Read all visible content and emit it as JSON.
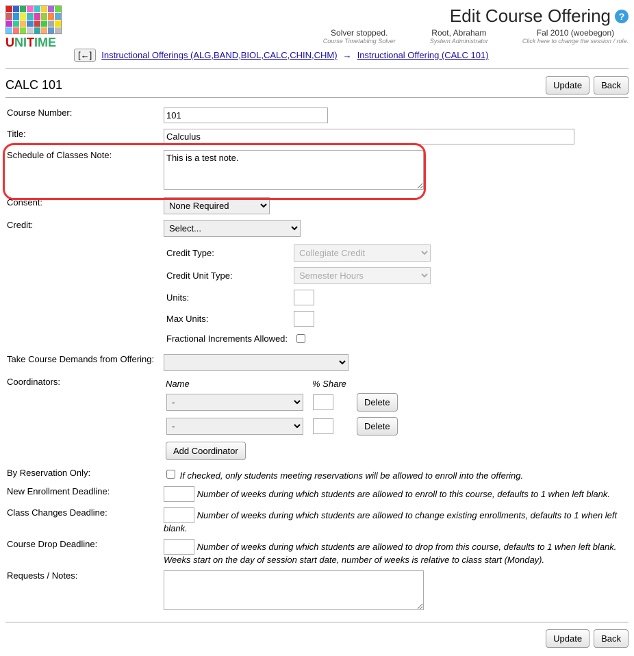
{
  "header": {
    "page_title": "Edit Course Offering",
    "help_icon": "?",
    "status": {
      "solver": {
        "main": "Solver stopped.",
        "sub": "Course Timetabling Solver"
      },
      "user": {
        "main": "Root, Abraham",
        "sub": "System Administrator"
      },
      "session": {
        "main": "Fal 2010 (woebegon)",
        "sub": "Click here to change the session / role."
      }
    },
    "breadcrumb": {
      "back_glyph": "[←]",
      "link1": "Instructional Offerings (ALG,BAND,BIOL,CALC,CHIN,CHM)",
      "arrow": "→",
      "link2": "Instructional Offering (CALC 101)"
    }
  },
  "course": "CALC 101",
  "buttons": {
    "update": "Update",
    "back": "Back",
    "delete": "Delete",
    "add_coordinator": "Add Coordinator"
  },
  "labels": {
    "course_number": "Course Number:",
    "title": "Title:",
    "sched_note": "Schedule of Classes Note:",
    "consent": "Consent:",
    "credit": "Credit:",
    "credit_type": "Credit Type:",
    "credit_unit_type": "Credit Unit Type:",
    "units": "Units:",
    "max_units": "Max Units:",
    "fractional": "Fractional Increments Allowed:",
    "take_demands": "Take Course Demands from Offering:",
    "coordinators": "Coordinators:",
    "coord_name": "Name",
    "coord_share": "% Share",
    "by_reservation": "By Reservation Only:",
    "new_enroll": "New Enrollment Deadline:",
    "class_changes": "Class Changes Deadline:",
    "course_drop": "Course Drop Deadline:",
    "requests": "Requests / Notes:"
  },
  "values": {
    "course_number": "101",
    "title": "Calculus",
    "sched_note": "This is a test note.",
    "consent": "None Required",
    "credit_format": "Select...",
    "credit_type": "Collegiate Credit",
    "credit_unit_type": "Semester Hours",
    "units": "",
    "max_units": "",
    "fractional": false,
    "take_demands": "",
    "coordinators": [
      {
        "name": "-",
        "share": ""
      },
      {
        "name": "-",
        "share": ""
      }
    ],
    "by_reservation": false,
    "new_enroll": "",
    "class_changes": "",
    "course_drop": "",
    "requests": ""
  },
  "hints": {
    "by_reservation": "If checked, only students meeting reservations will be allowed to enroll into the offering.",
    "new_enroll": "Number of weeks during which students are allowed to enroll to this course, defaults to 1 when left blank.",
    "class_changes": "Number of weeks during which students are allowed to change existing enrollments, defaults to 1 when left blank.",
    "course_drop": "Number of weeks during which students are allowed to drop from this course, defaults to 1 when left blank.",
    "weeks_note": "Weeks start on the day of session start date, number of weeks is relative to class start (Monday)."
  },
  "logo_colors": [
    "#d22",
    "#36c",
    "#3a6",
    "#f6c",
    "#3cc",
    "#fc3",
    "#a6d",
    "#6d3",
    "#c66",
    "#39d",
    "#ee4",
    "#4bb",
    "#d4a",
    "#9c4",
    "#f84",
    "#6ad",
    "#c3c",
    "#3c9",
    "#fb5",
    "#48c",
    "#c44",
    "#4c4",
    "#aaa",
    "#fd0",
    "#6cf",
    "#f77",
    "#8d4",
    "#ccc",
    "#3aa",
    "#fa6",
    "#69c",
    "#bbb"
  ]
}
